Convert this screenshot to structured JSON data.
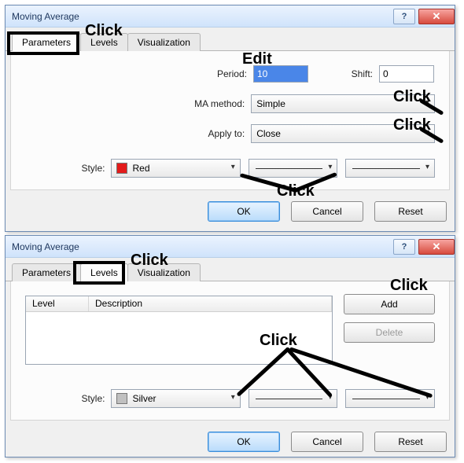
{
  "annotations": {
    "click": "Click",
    "edit": "Edit"
  },
  "dialog1": {
    "title": "Moving Average",
    "tabs": {
      "parameters": "Parameters",
      "levels": "Levels",
      "visualization": "Visualization"
    },
    "labels": {
      "period": "Period:",
      "shift": "Shift:",
      "method": "MA method:",
      "apply": "Apply to:",
      "style": "Style:"
    },
    "values": {
      "period": "10",
      "shift": "0",
      "method": "Simple",
      "apply": "Close",
      "color": "Red"
    },
    "buttons": {
      "ok": "OK",
      "cancel": "Cancel",
      "reset": "Reset"
    }
  },
  "dialog2": {
    "title": "Moving Average",
    "tabs": {
      "parameters": "Parameters",
      "levels": "Levels",
      "visualization": "Visualization"
    },
    "columns": {
      "level": "Level",
      "description": "Description"
    },
    "labels": {
      "style": "Style:"
    },
    "values": {
      "color": "Silver"
    },
    "buttons": {
      "add": "Add",
      "delete": "Delete",
      "ok": "OK",
      "cancel": "Cancel",
      "reset": "Reset"
    }
  }
}
